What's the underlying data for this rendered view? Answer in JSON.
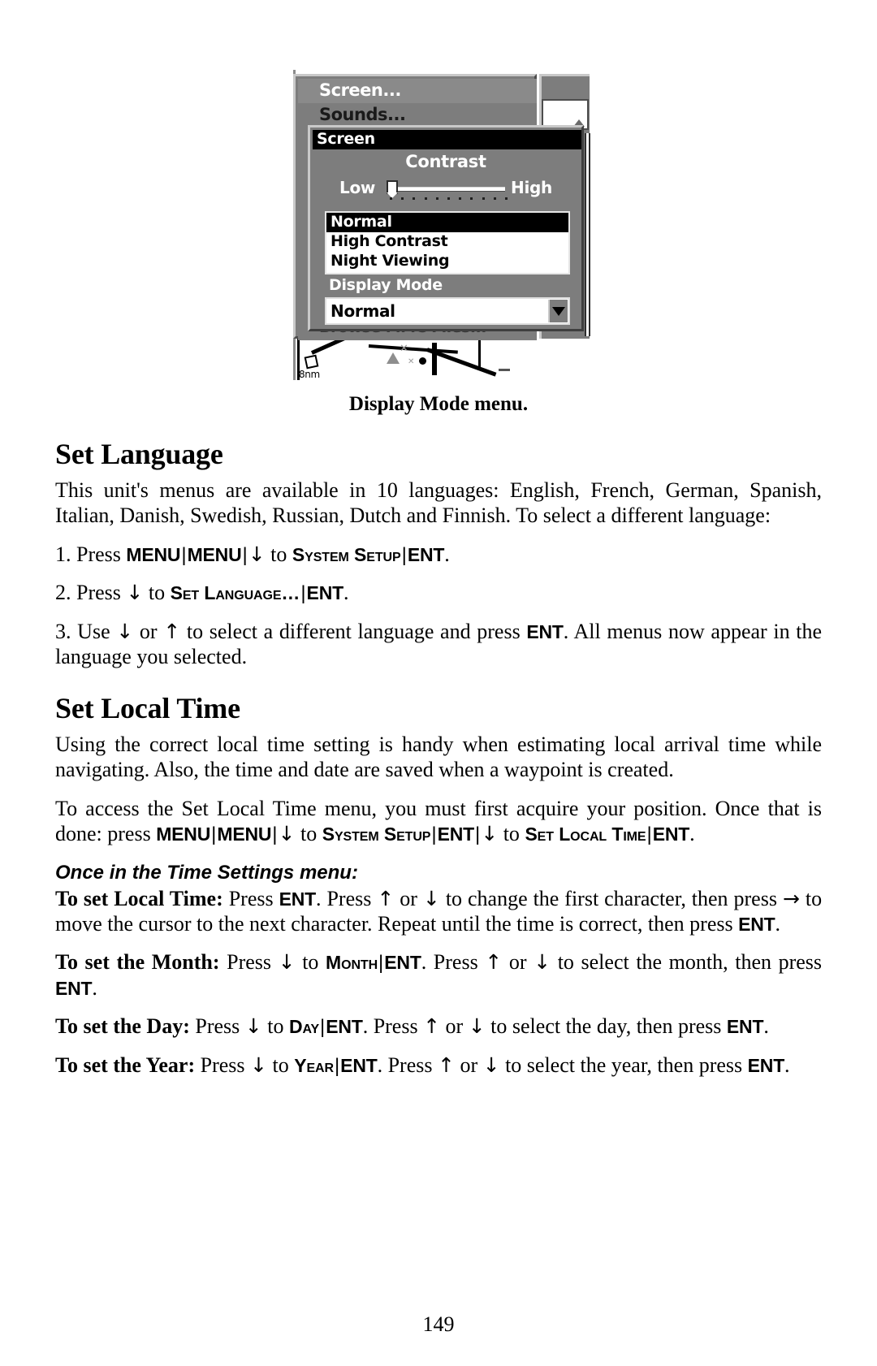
{
  "figure": {
    "caption": "Display Mode menu.",
    "background_menu": {
      "items": [
        "Screen...",
        "Sounds...",
        "",
        "Browse MMC Files..."
      ]
    },
    "dialog": {
      "title": "Screen",
      "contrast_label": "Contrast",
      "slider_low_label": "Low",
      "slider_high_label": "High",
      "slider_value_percent": 4,
      "list_items": [
        "Normal",
        "High Contrast",
        "Night Viewing"
      ],
      "list_selected": "Normal",
      "section_label": "Display Mode",
      "combo_value": "Normal"
    },
    "map": {
      "scale_label": "8nm"
    }
  },
  "sections": [
    {
      "heading": "Set Language",
      "intro": "This unit's menus are available in 10 languages: English, French, German, Spanish, Italian, Danish, Swedish, Russian, Dutch and Finnish. To select a different language:"
    },
    {
      "heading": "Set Local Time"
    }
  ],
  "language_steps": {
    "step1": {
      "num": "1.",
      "press": "Press",
      "key_menu": "MENU",
      "pipe": "|",
      "arrow_down": "↓",
      "to": "to",
      "menu_system_setup": "System Setup",
      "key_ent": "ENT",
      "period": "."
    },
    "step2": {
      "num": "2.",
      "press": "Press",
      "arrow_down": "↓",
      "to": "to",
      "menu_set_language": "Set Language…",
      "pipe": "|",
      "key_ent": "ENT",
      "period": "."
    },
    "step3": {
      "num": "3.",
      "use": "Use",
      "arrow_down": "↓",
      "or": "or",
      "arrow_up": "↑",
      "mid": "to select a different language and press",
      "key_ent": "ENT",
      "tail": ". All menus now appear in the language you selected."
    }
  },
  "local_time": {
    "para1": "Using the correct local time setting is handy when estimating local arrival time while navigating. Also, the time and date are saved when a waypoint is created.",
    "para2_a": "To access the Set Local Time menu, you must first acquire your position. Once that is done: press",
    "key_menu": "MENU",
    "pipe": "|",
    "arrow_down": "↓",
    "to": "to",
    "menu_system_setup": "System Setup",
    "key_ent": "ENT",
    "menu_set_local_time": "Set Local Time",
    "period": ".",
    "subhead": "Once in the Time Settings menu:",
    "set_time": {
      "lead": "To set Local Time:",
      "a": "Press",
      "key_ent": "ENT",
      "b": ". Press",
      "arrow_up": "↑",
      "or": "or",
      "arrow_down": "↓",
      "c": "to change the first character, then press",
      "arrow_right": "→",
      "d": "to move the cursor to the next character. Repeat until the time is correct, then press",
      "e": "."
    },
    "set_month": {
      "lead": "To set the Month:",
      "a": "Press",
      "arrow_down": "↓",
      "to": "to",
      "menu": "Month",
      "pipe": "|",
      "key_ent": "ENT",
      "b": ". Press",
      "arrow_up": "↑",
      "or": "or",
      "c": "to select the month, then press",
      "d": "."
    },
    "set_day": {
      "lead": "To set the Day:",
      "a": "Press",
      "arrow_down": "↓",
      "to": "to",
      "menu": "Day",
      "pipe": "|",
      "key_ent": "ENT",
      "b": ". Press",
      "arrow_up": "↑",
      "or": "or",
      "c": "to select the day, then press",
      "d": "."
    },
    "set_year": {
      "lead": "To set the Year:",
      "a": "Press",
      "arrow_down": "↓",
      "to": "to",
      "menu": "Year",
      "pipe": "|",
      "key_ent": "ENT",
      "b": ". Press",
      "arrow_up": "↑",
      "or": "or",
      "c": "to select the year, then press",
      "d": "."
    }
  },
  "page_number": "149"
}
